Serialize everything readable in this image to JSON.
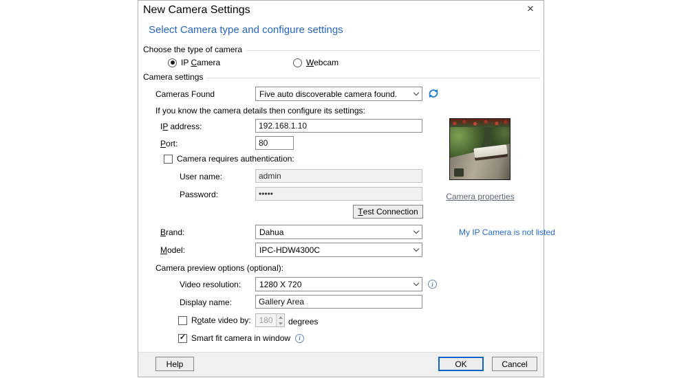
{
  "window": {
    "title": "New Camera Settings",
    "heading": "Select Camera type and configure settings"
  },
  "icons": {
    "close": "×"
  },
  "camera_type": {
    "group_label": "Choose the type of camera",
    "ip_camera": {
      "text": "IP Camera",
      "accel": 3
    },
    "webcam": {
      "text": "Webcam",
      "accel": 0
    },
    "selected": "IP Camera"
  },
  "settings": {
    "group_label": "Camera settings",
    "cameras_found": {
      "label": "Cameras Found",
      "value": "Five auto discoverable camera found."
    },
    "hint": "If you know the camera details then configure its settings:",
    "ip_address": {
      "label": {
        "text": "IP address:",
        "accel": 1
      },
      "value": "192.168.1.10"
    },
    "port": {
      "label": {
        "text": "Port:",
        "accel": 0
      },
      "value": "80"
    },
    "auth": {
      "label": "Camera requires authentication:",
      "checked": false
    },
    "username": {
      "label": "User name:",
      "value": "admin",
      "enabled": false
    },
    "password": {
      "label": "Password:",
      "value": "•••••",
      "enabled": false
    },
    "test_connection": {
      "text": "Test Connection",
      "accel": 0
    },
    "brand": {
      "label": {
        "text": "Brand:",
        "accel": 0
      },
      "value": "Dahua"
    },
    "model": {
      "label": {
        "text": "Model:",
        "accel": 0
      },
      "value": "IPC-HDW4300C"
    },
    "preview_options_label": "Camera preview options (optional):",
    "video_resolution": {
      "label": "Video resolution:",
      "value": "1280 X 720"
    },
    "display_name": {
      "label": "Display name:",
      "value": "Gallery Area"
    },
    "rotate": {
      "label": {
        "text": "Rotate video by:",
        "accel": 1
      },
      "value": "180",
      "suffix": "degrees",
      "checked": false,
      "enabled": false
    },
    "smart_fit": {
      "label": "Smart fit camera in window",
      "checked": true
    }
  },
  "right_panel": {
    "camera_properties": "Camera properties",
    "not_listed": "My IP Camera is not listed"
  },
  "footer": {
    "help": "Help",
    "ok": "OK",
    "cancel": "Cancel"
  },
  "colors": {
    "heading_blue": "#2566bd",
    "link_blue": "#2569cf",
    "link_gray": "#5a6573",
    "default_button_border": "#0a64c8",
    "footer_bg": "#f0f0f0"
  }
}
